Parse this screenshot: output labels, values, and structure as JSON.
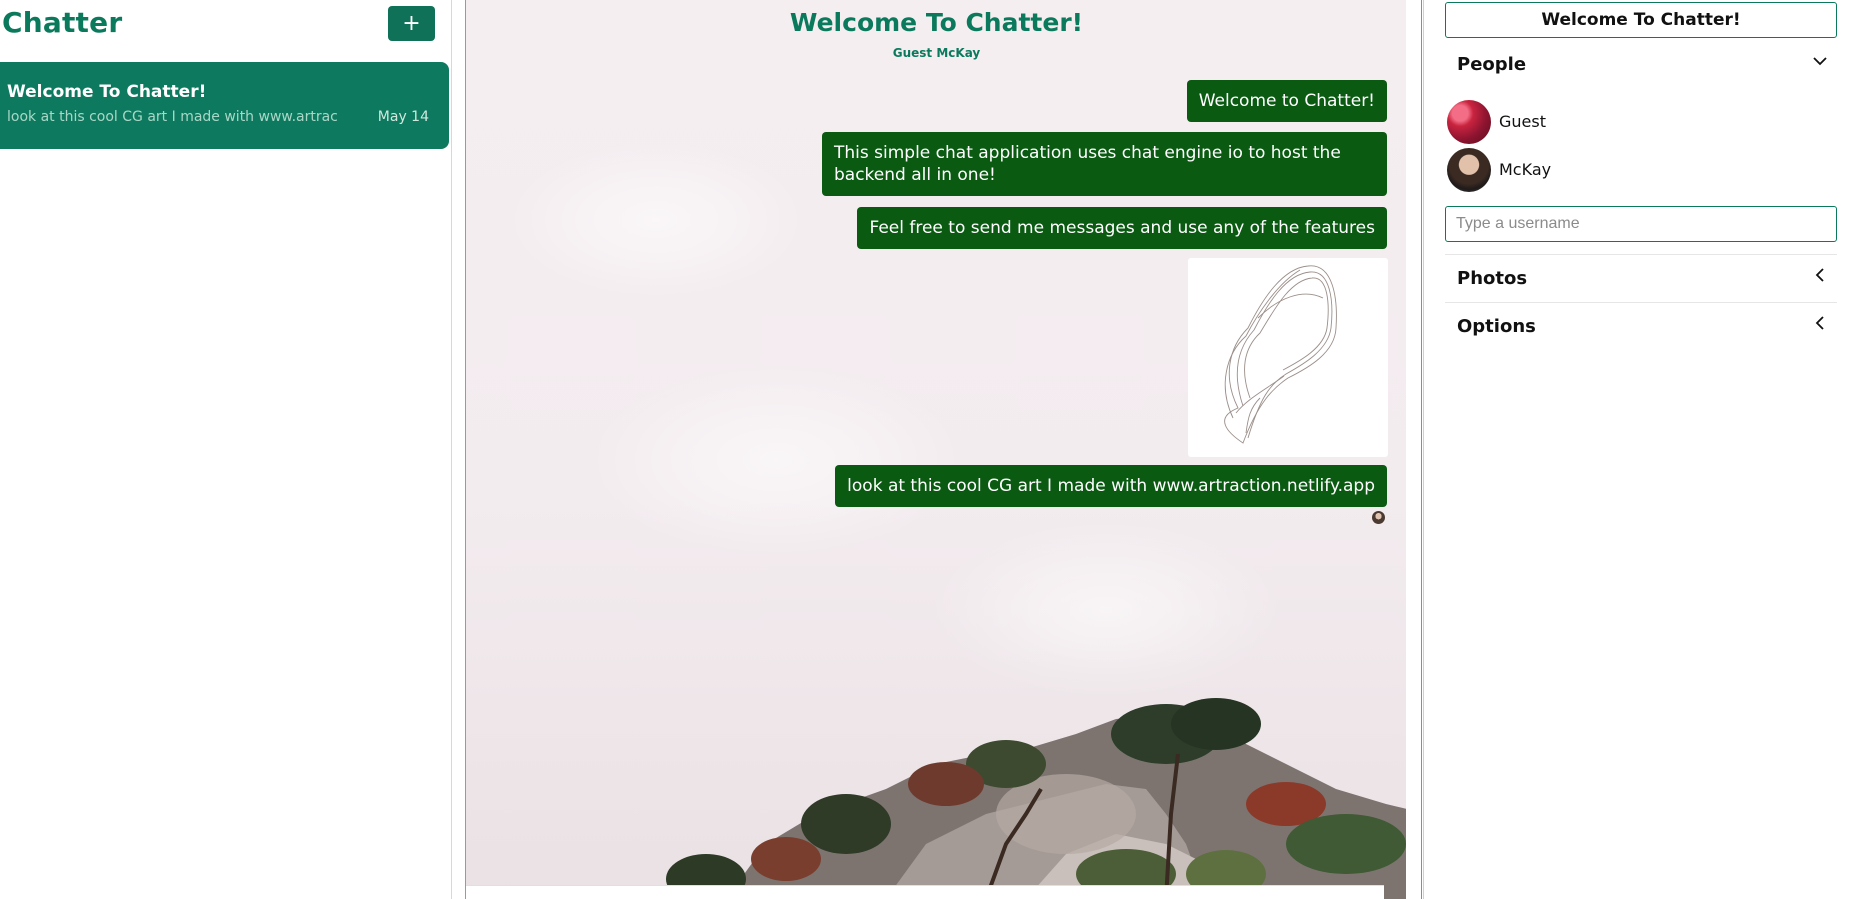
{
  "sidebar": {
    "title": "Chatter",
    "add_label": "+",
    "chats": [
      {
        "title": "Welcome To Chatter!",
        "last_message": "look at this cool CG art I made with www.artrac",
        "date": "May 14"
      }
    ]
  },
  "feed": {
    "title": "Welcome To Chatter!",
    "subtitle": "Guest McKay",
    "messages": [
      {
        "type": "text",
        "text": "Welcome to Chatter!"
      },
      {
        "type": "text",
        "text": "This simple chat application uses chat engine io to host the backend all in one!"
      },
      {
        "type": "text",
        "text": "Feel free to send me messages and use any of the features"
      },
      {
        "type": "image",
        "text": ""
      },
      {
        "type": "text",
        "text": "look at this cool CG art I made with www.artraction.netlify.app"
      }
    ]
  },
  "settings": {
    "title": "Welcome To Chatter!",
    "people": {
      "label": "People",
      "members": [
        {
          "name": "Guest"
        },
        {
          "name": "McKay"
        }
      ],
      "input_placeholder": "Type a username"
    },
    "photos": {
      "label": "Photos"
    },
    "options": {
      "label": "Options"
    }
  },
  "colors": {
    "accent": "#0b7a5c",
    "card": "#0d7a5f",
    "bubble": "#0a5a12"
  },
  "icons": {
    "add": "plus-icon",
    "people_toggle": "chevron-down-icon",
    "photos_toggle": "chevron-left-icon",
    "options_toggle": "chevron-left-icon"
  }
}
